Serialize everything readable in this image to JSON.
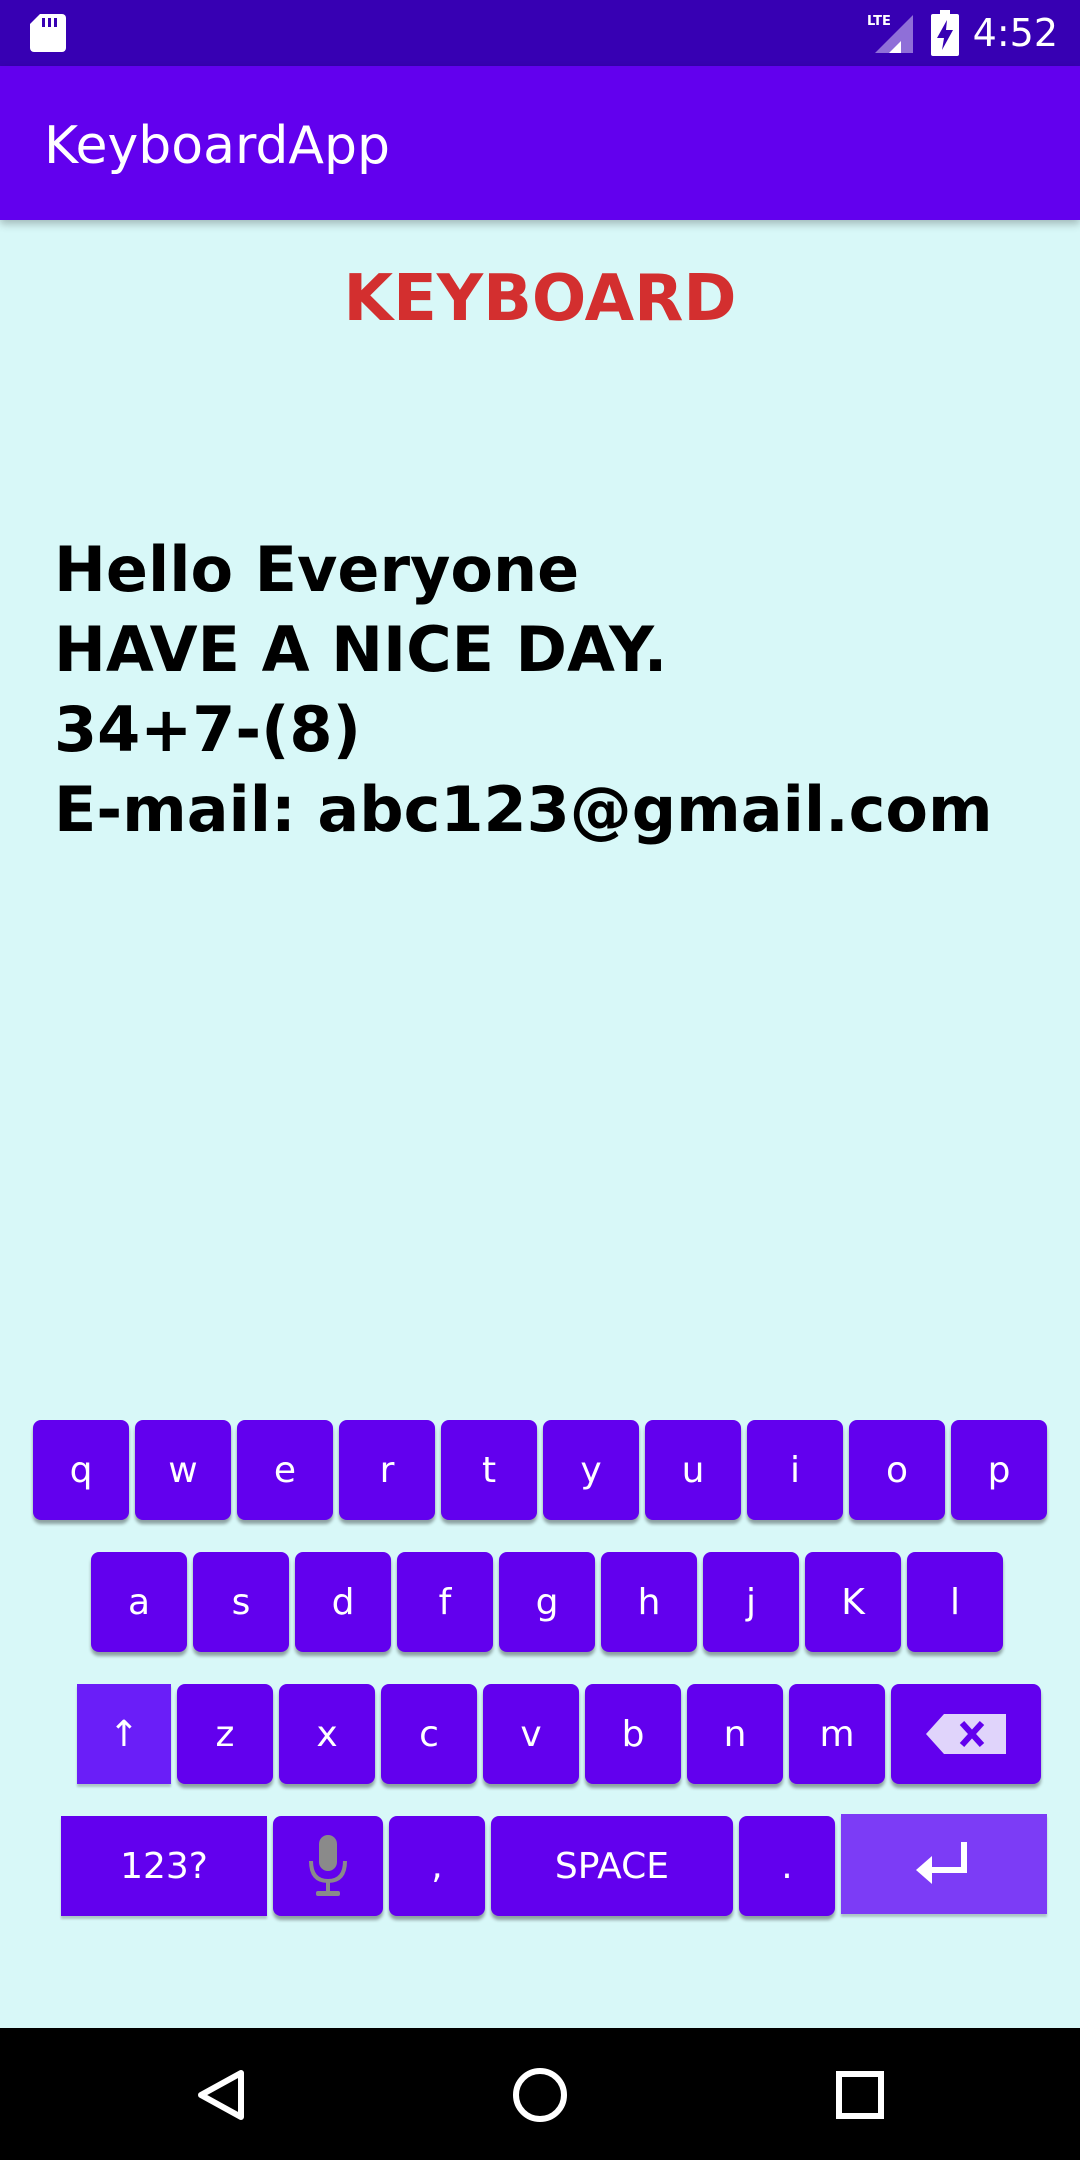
{
  "status_bar": {
    "time": "4:52",
    "network": "LTE",
    "icons": [
      "sd-card-icon",
      "signal-icon",
      "battery-charging-icon"
    ]
  },
  "app_bar": {
    "title": "KeyboardApp"
  },
  "main": {
    "heading": "KEYBOARD",
    "text_lines": [
      "Hello Everyone",
      "HAVE A NICE DAY.",
      "34+7-(8)",
      "E-mail: abc123@gmail.com"
    ]
  },
  "keyboard": {
    "row1": [
      "q",
      "w",
      "e",
      "r",
      "t",
      "y",
      "u",
      "i",
      "o",
      "p"
    ],
    "row2": [
      "a",
      "s",
      "d",
      "f",
      "g",
      "h",
      "j",
      "K",
      "l"
    ],
    "row3": [
      "z",
      "x",
      "c",
      "v",
      "b",
      "n",
      "m"
    ],
    "shift_label": "↑",
    "symbols_label": "123?",
    "comma_label": ",",
    "space_label": "SPACE",
    "period_label": ".",
    "icons": [
      "shift-icon",
      "backspace-icon",
      "microphone-icon",
      "enter-icon"
    ]
  },
  "colors": {
    "status_bar": "#3700b3",
    "app_bar": "#6200ee",
    "background": "#d8f8f8",
    "heading": "#d32f2f",
    "key": "#6200ee"
  },
  "nav_bar": {
    "icons": [
      "back-icon",
      "home-icon",
      "recents-icon"
    ]
  }
}
